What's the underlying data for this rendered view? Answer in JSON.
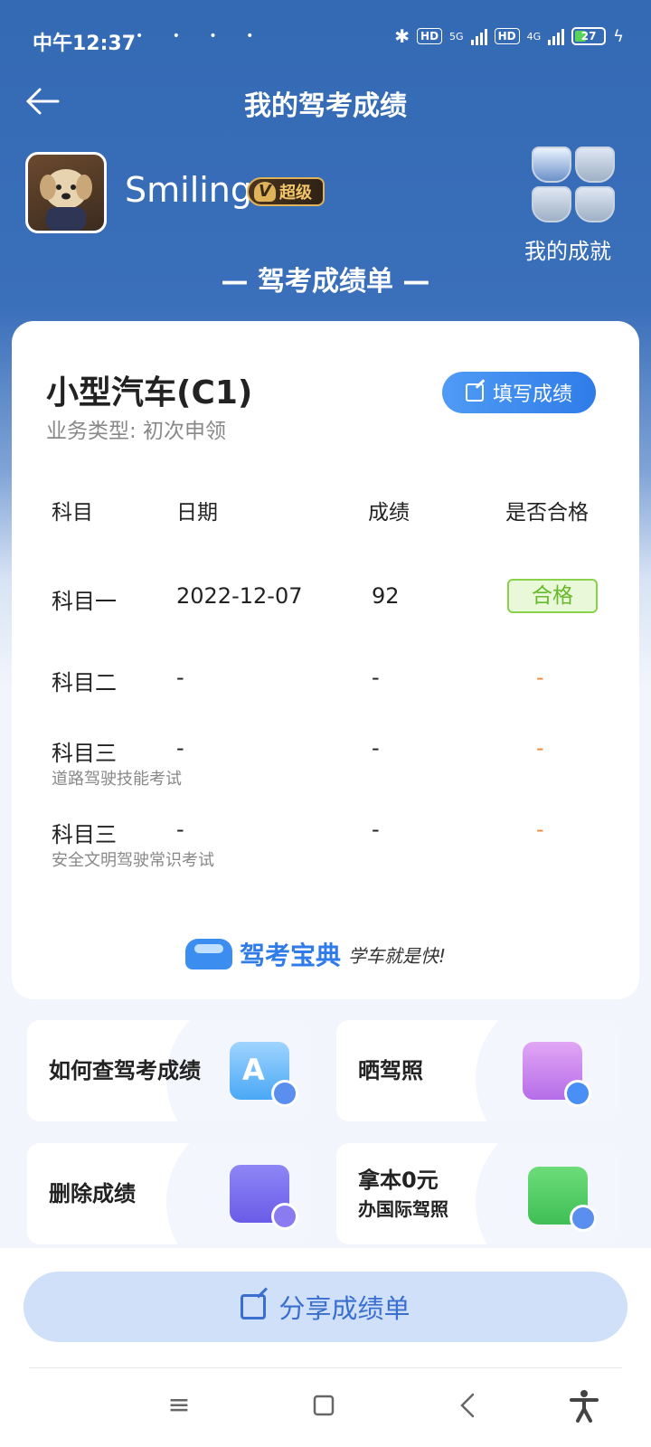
{
  "status_bar": {
    "time": "中午12:37",
    "dots": "• • • •",
    "hd1": "HD",
    "net1": "5G",
    "hd2": "HD",
    "net2": "4G",
    "battery": "27"
  },
  "header": {
    "title": "我的驾考成绩"
  },
  "profile": {
    "username": "Smiling",
    "vip_label": "超级",
    "vip_v": "V",
    "achievements_label": "我的成就"
  },
  "sheet_title": "— 驾考成绩单 —",
  "card": {
    "car_type": "小型汽车(C1)",
    "business_type": "业务类型: 初次申领",
    "fill_button": "填写成绩",
    "columns": [
      "科目",
      "日期",
      "成绩",
      "是否合格"
    ],
    "rows": [
      {
        "subject": "科目一",
        "note": "",
        "date": "2022-12-07",
        "score": "92",
        "result": "合格"
      },
      {
        "subject": "科目二",
        "note": "",
        "date": "-",
        "score": "-",
        "result": "-"
      },
      {
        "subject": "科目三",
        "note": "道路驾驶技能考试",
        "date": "-",
        "score": "-",
        "result": "-"
      },
      {
        "subject": "科目三",
        "note": "安全文明驾驶常识考试",
        "date": "-",
        "score": "-",
        "result": "-"
      }
    ],
    "logo_name": "驾考宝典",
    "logo_slogan": "学车就是快!"
  },
  "tiles": [
    {
      "label": "如何查驾考成绩"
    },
    {
      "label": "晒驾照"
    },
    {
      "label": "删除成绩"
    },
    {
      "label_line1": "拿本0元",
      "label_line2": "办国际驾照"
    }
  ],
  "share_button": "分享成绩单",
  "colors": {
    "header_blue": "#3469b4",
    "accent_blue": "#2f7ce8",
    "pass_green": "#67b82a",
    "dash_orange": "#f08a3a"
  }
}
